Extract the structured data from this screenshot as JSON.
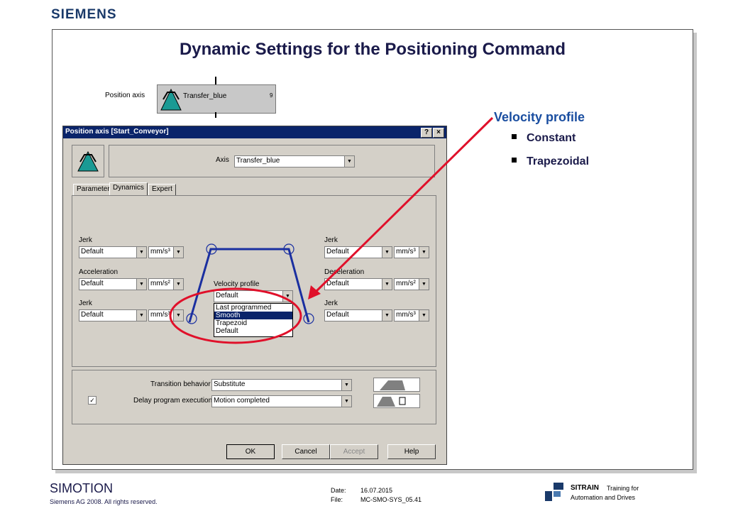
{
  "brand": "SIEMENS",
  "slide_title": "Dynamic Settings for the Positioning Command",
  "position_axis_block": {
    "label": "Position axis",
    "axis_name": "Transfer_blue",
    "number": "9"
  },
  "velocity_profile_info": {
    "title": "Velocity profile",
    "items": [
      "Constant",
      "Trapezoidal"
    ]
  },
  "dialog": {
    "title": "Position axis [Start_Conveyor]",
    "help_btn": "?",
    "close_btn": "×",
    "axis_label": "Axis",
    "axis_value": "Transfer_blue",
    "tabs": [
      "Parameter",
      "Dynamics",
      "Expert"
    ],
    "active_tab": "Dynamics",
    "left": {
      "jerk1_label": "Jerk",
      "jerk1_value": "Default",
      "jerk1_unit": "mm/s³",
      "accel_label": "Acceleration",
      "accel_value": "Default",
      "accel_unit": "mm/s²",
      "jerk2_label": "Jerk",
      "jerk2_value": "Default",
      "jerk2_unit": "mm/s³"
    },
    "right": {
      "jerk1_label": "Jerk",
      "jerk1_value": "Default",
      "jerk1_unit": "mm/s³",
      "decel_label": "Deceleration",
      "decel_value": "Default",
      "decel_unit": "mm/s²",
      "jerk2_label": "Jerk",
      "jerk2_value": "Default",
      "jerk2_unit": "mm/s³"
    },
    "velocity_profile": {
      "label": "Velocity profile",
      "value": "Default",
      "options": [
        "Last programmed",
        "Smooth",
        "Trapezoid",
        "Default"
      ],
      "highlighted": "Smooth"
    },
    "transition_label": "Transition behavior",
    "transition_value": "Substitute",
    "delay_label": "Delay program execution",
    "delay_checked": true,
    "delay_value": "Motion completed",
    "buttons": {
      "ok": "OK",
      "cancel": "Cancel",
      "accept": "Accept",
      "help": "Help"
    }
  },
  "colors": {
    "annotation_red": "#e0102a",
    "title_bar": "#0a246a",
    "accent_blue": "#1a4ea0",
    "curve_blue": "#1a2fa0"
  },
  "footer": {
    "product": "SIMOTION",
    "copyright": "Siemens AG 2008. All rights reserved.",
    "date_label": "Date:",
    "date": "16.07.2015",
    "file_label": "File:",
    "file": "MC-SMO-SYS_05.41",
    "sitrain": "SITRAIN",
    "sitrain_tag1": "Training for",
    "sitrain_tag2": "Automation and Drives"
  }
}
